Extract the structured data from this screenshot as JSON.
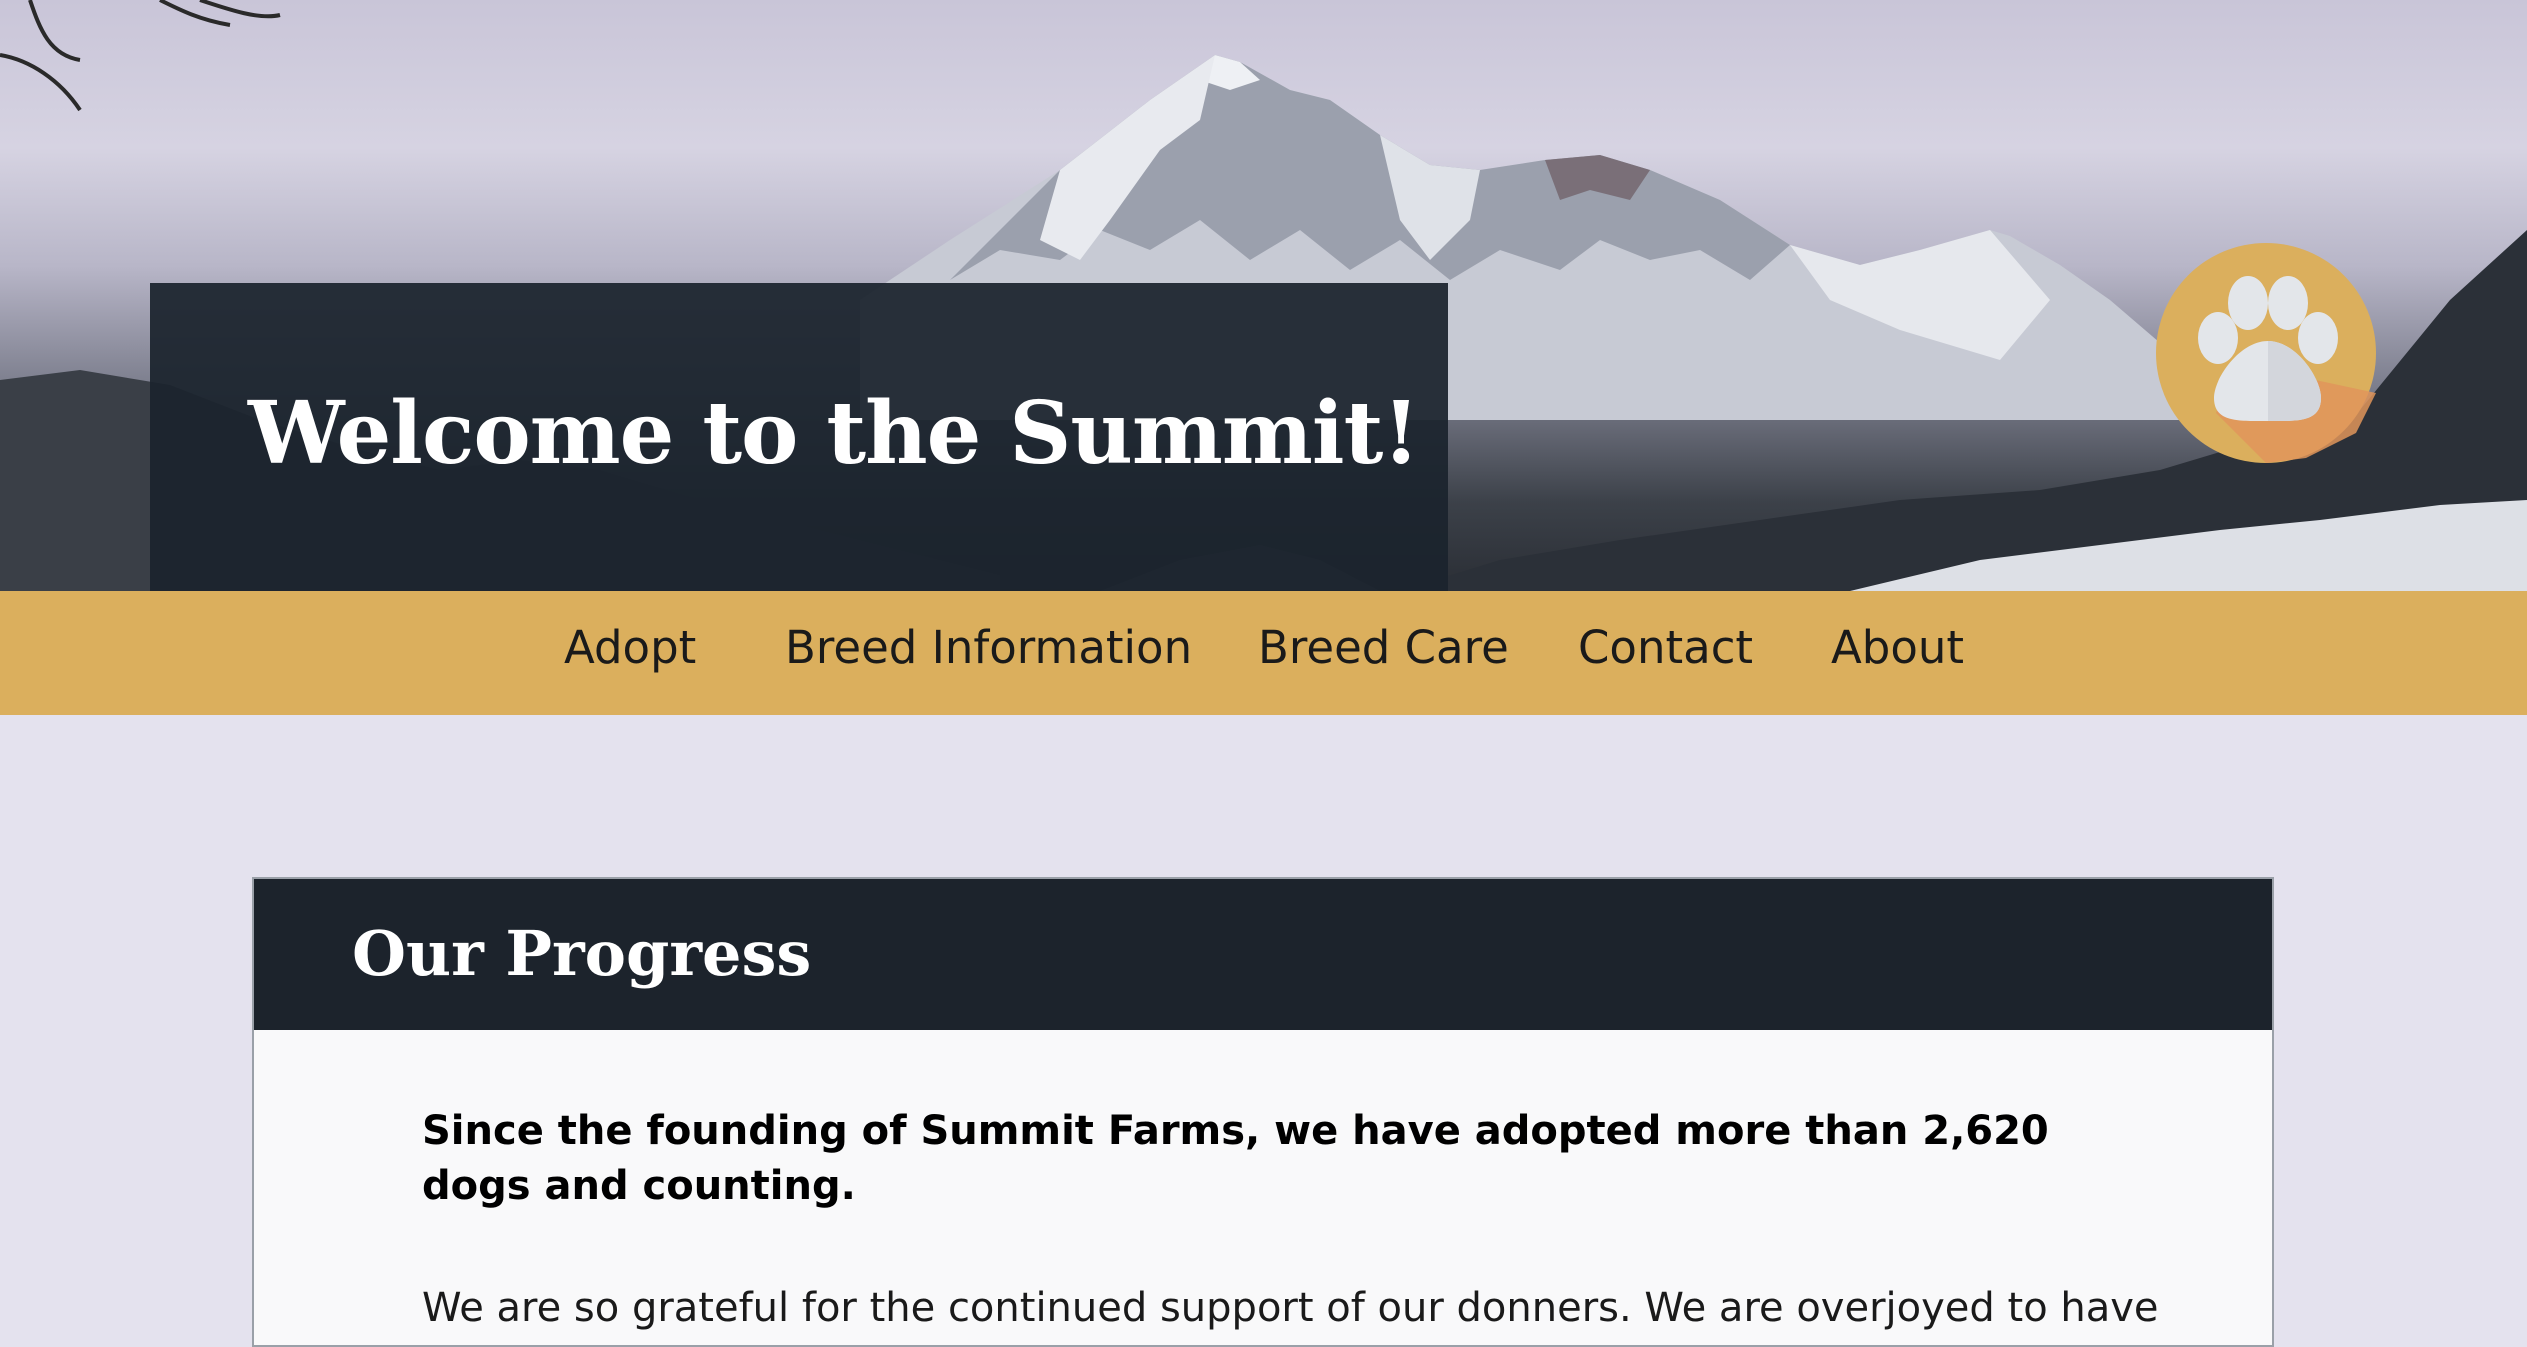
{
  "header": {
    "title": "Welcome to the Summit!",
    "logo_icon": "paw-print-icon",
    "background": "snowy-mountain-photo"
  },
  "nav": {
    "items": [
      {
        "label": "Adopt"
      },
      {
        "label": "Breed Information"
      },
      {
        "label": "Breed Care"
      },
      {
        "label": "Contact"
      },
      {
        "label": "About"
      }
    ]
  },
  "progress": {
    "heading": "Our Progress",
    "lead": "Since the founding of Summit Farms, we have adopted more than 2,620 dogs and counting.",
    "body": "We are so grateful for the continued support of our donners. We are overjoyed to have so"
  },
  "colors": {
    "page_bg": "#e4e2ee",
    "nav_bg": "#dbaf5d",
    "dark_panel": "#1c232c",
    "card_bg": "#f9f9fa",
    "logo_circle": "#dbaf5d",
    "logo_shadow": "#e0955a",
    "logo_paw": "#e3e6ea"
  }
}
